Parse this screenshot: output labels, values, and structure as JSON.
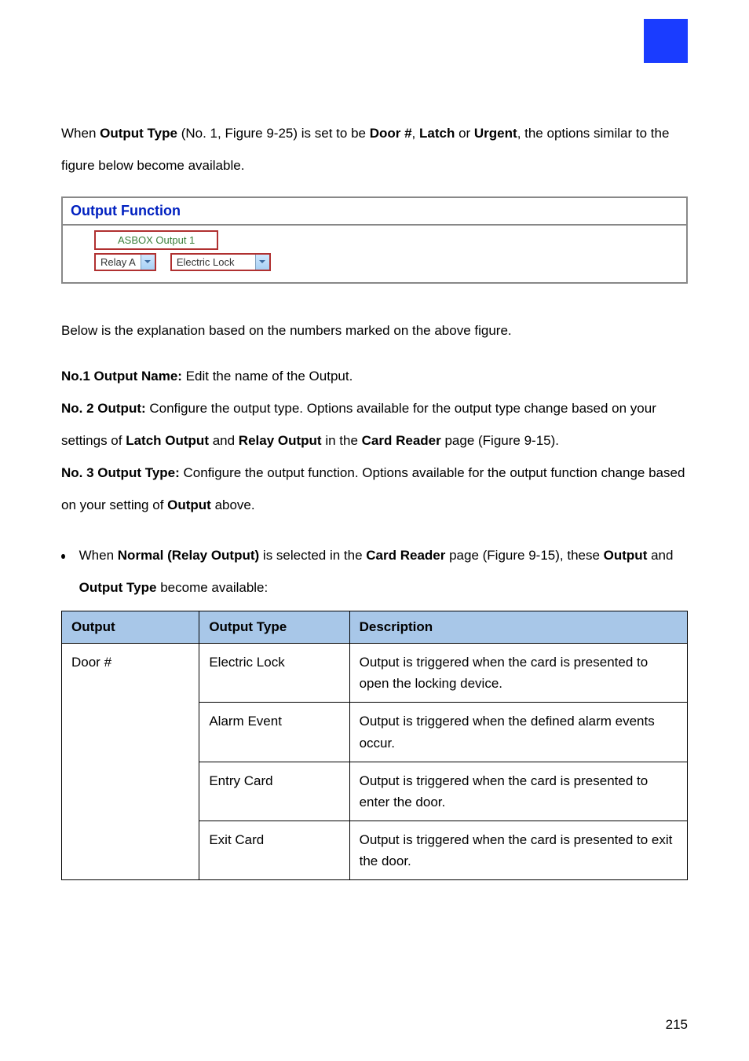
{
  "intro": {
    "t1": "When ",
    "bold1": "Output Type",
    "t2": " (No. 1, Figure 9-25) is set to be ",
    "bold2": "Door #",
    "t3": ", ",
    "bold3": "Latch",
    "t4": " or ",
    "bold4": "Urgent",
    "t5": ", the options similar to the figure below become available."
  },
  "panel": {
    "title": "Output Function",
    "tab": "ASBOX Output 1",
    "sel1": "Relay A",
    "sel2": "Electric Lock"
  },
  "below_line": "Below is the explanation based on the numbers marked on the above figure.",
  "n1": {
    "label": "No.1 Output Name: ",
    "text": "Edit the name of the Output."
  },
  "n2": {
    "label": "No. 2 Output: ",
    "t1": "Configure the output type. Options available for the output type change based on your settings of ",
    "b1": "Latch Output",
    "t2": " and ",
    "b2": "Relay Output",
    "t3": " in the ",
    "b3": "Card Reader",
    "t4": " page (Figure 9-15)."
  },
  "n3": {
    "label": "No. 3 Output Type: ",
    "t1": "Configure the output function. Options available for the output function change based on your setting of ",
    "b1": "Output",
    "t2": " above."
  },
  "bullet": {
    "t1": "When ",
    "b1": "Normal (Relay Output)",
    "t2": " is selected in the ",
    "b2": "Card Reader",
    "t3": " page (Figure 9-15), these ",
    "b3": "Output",
    "t4": " and ",
    "b4": "Output Type",
    "t5": " become available:"
  },
  "table": {
    "h1": "Output",
    "h2": "Output Type",
    "h3": "Description",
    "rows": [
      {
        "c1": "Door #",
        "c2": "Electric Lock",
        "c3": "Output is triggered when the card is presented to open the locking device."
      },
      {
        "c2": "Alarm Event",
        "c3": "Output is triggered when the defined alarm events occur."
      },
      {
        "c2": "Entry Card",
        "c3": "Output is triggered when the card is presented to enter the door."
      },
      {
        "c2": "Exit Card",
        "c3": "Output is triggered when the card is presented to exit the door."
      }
    ]
  },
  "pageno": "215",
  "chart_data": {
    "type": "table",
    "headers": [
      "Output",
      "Output Type",
      "Description"
    ],
    "rows": [
      [
        "Door #",
        "Electric Lock",
        "Output is triggered when the card is presented to open the locking device."
      ],
      [
        "Door #",
        "Alarm Event",
        "Output is triggered when the defined alarm events occur."
      ],
      [
        "Door #",
        "Entry Card",
        "Output is triggered when the card is presented to enter the door."
      ],
      [
        "Door #",
        "Exit Card",
        "Output is triggered when the card is presented to exit the door."
      ]
    ]
  }
}
